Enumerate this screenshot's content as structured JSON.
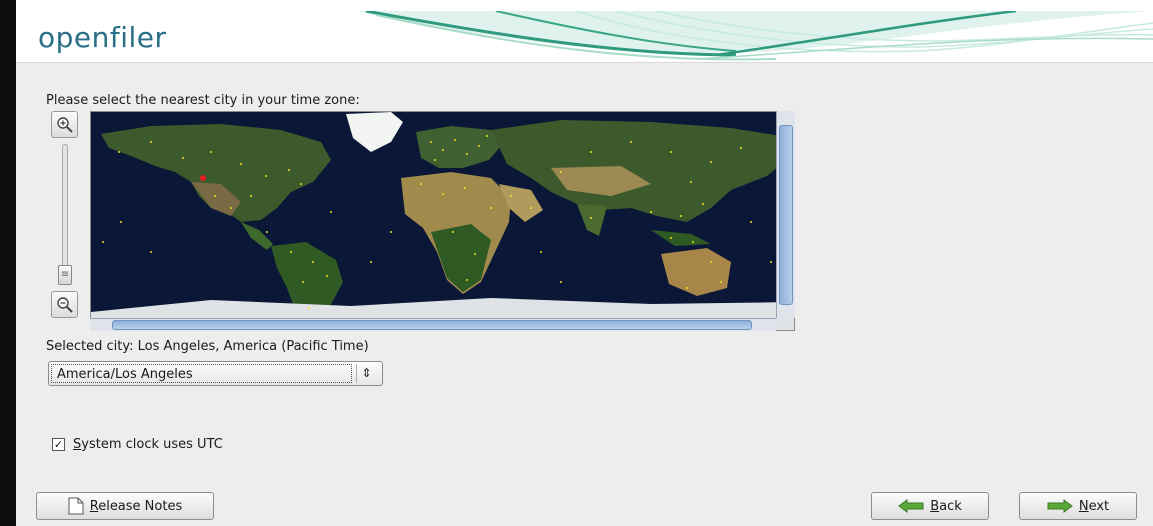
{
  "banner": {
    "logo_text": "openfiler"
  },
  "timezone": {
    "prompt": "Please select the nearest city in your time zone:",
    "selected_city_label": "Selected city: Los Angeles, America (Pacific Time)",
    "select_value": "America/Los Angeles"
  },
  "options": {
    "utc_checked": true,
    "utc_label_mnemonic": "S",
    "utc_label_rest": "ystem clock uses UTC"
  },
  "buttons": {
    "release_notes_mnemonic": "R",
    "release_notes_rest": "elease Notes",
    "back_mnemonic": "B",
    "back_rest": "ack",
    "next_mnemonic": "N",
    "next_rest": "ext"
  },
  "colors": {
    "logo": "#2a6f86",
    "ocean": "#0a1530",
    "city_marker": "#f0e020",
    "selected_city_marker": "#e02020"
  }
}
